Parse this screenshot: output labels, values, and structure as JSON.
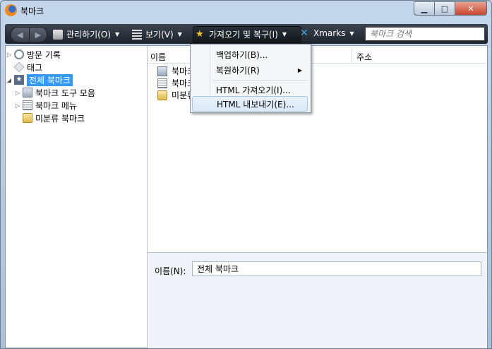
{
  "window": {
    "title": "북마크"
  },
  "toolbar": {
    "back_icon": "back-arrow-icon",
    "forward_icon": "forward-arrow-icon",
    "manage_label": "관리하기(O)",
    "view_label": "보기(V)",
    "import_label": "가져오기 및 복구(I)",
    "xmarks_label": "Xmarks",
    "search_placeholder": "북마크 검색"
  },
  "tree": {
    "items": [
      {
        "label": "방문 기록",
        "icon": "clock-icon"
      },
      {
        "label": "태그",
        "icon": "tag-icon"
      },
      {
        "label": "전체 북마크",
        "icon": "bookmarks-star-icon"
      },
      {
        "label": "북마크 도구 모음",
        "icon": "toolbar-folder-icon"
      },
      {
        "label": "북마크 메뉴",
        "icon": "menu-folder-icon"
      },
      {
        "label": "미분류 북마크",
        "icon": "unsorted-folder-icon"
      }
    ]
  },
  "list": {
    "headers": {
      "name": "이름",
      "location": "주소"
    },
    "rows": [
      {
        "label": "북마크"
      },
      {
        "label": "북마크"
      },
      {
        "label": "미분류"
      }
    ]
  },
  "menu": {
    "items": [
      {
        "label": "백업하기(B)..."
      },
      {
        "label": "복원하기(R)"
      },
      {
        "label": "HTML 가져오기(I)..."
      },
      {
        "label": "HTML 내보내기(E)..."
      }
    ]
  },
  "detail": {
    "name_label": "이름(N):",
    "name_value": "전체 북마크"
  }
}
